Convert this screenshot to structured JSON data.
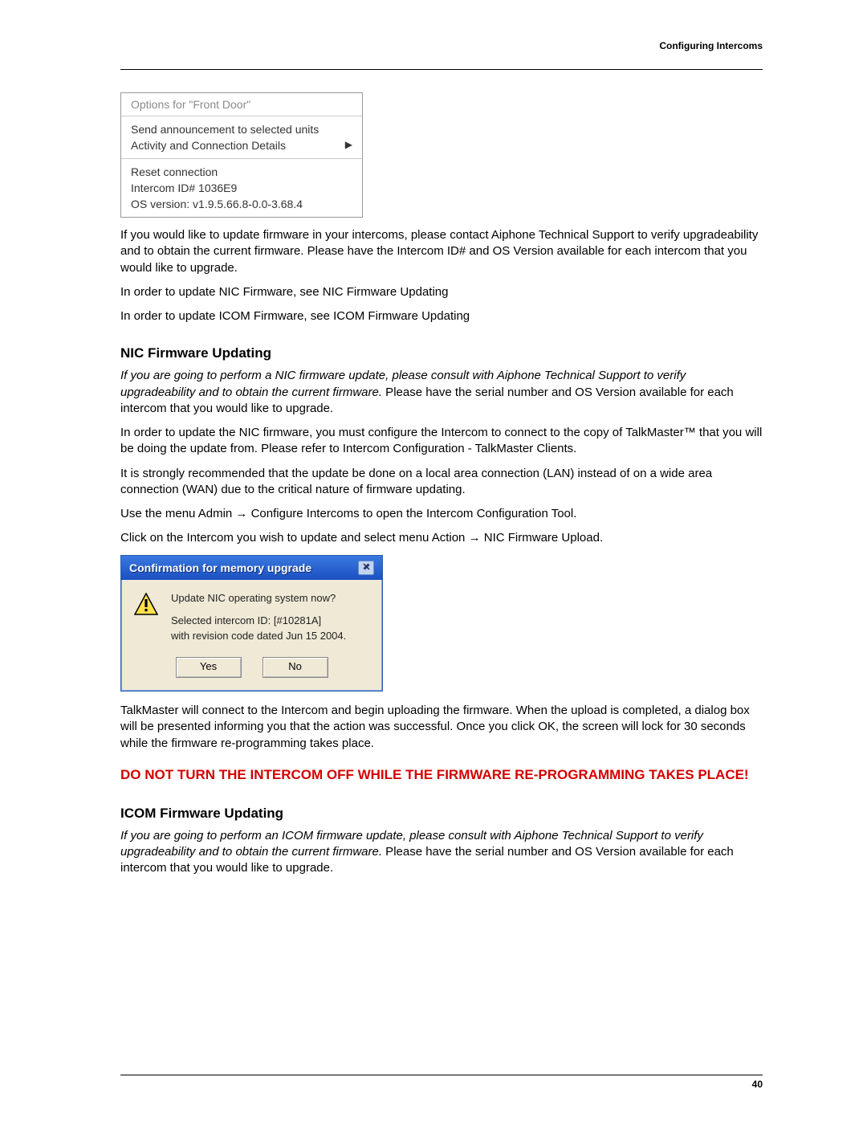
{
  "header": {
    "label": "Configuring Intercoms"
  },
  "footer": {
    "page": "40"
  },
  "context_menu": {
    "title": "Options for \"Front Door\"",
    "sec1": {
      "item1": "Send announcement to selected units",
      "item2": "Activity and Connection Details"
    },
    "sec2": {
      "item1": "Reset connection",
      "item2": "Intercom ID# 1036E9",
      "item3": "OS version: v1.9.5.66.8-0.0-3.68.4"
    }
  },
  "p1": "If you would like to update firmware in your intercoms, please contact Aiphone Technical Support to verify upgradeability and to obtain the current firmware.  Please have the Intercom ID# and OS Version available for each intercom that you would like to upgrade.",
  "p2": "In order to update NIC Firmware, see NIC Firmware Updating",
  "p3": "In order to update ICOM Firmware, see ICOM Firmware Updating",
  "section_nic": {
    "heading": "NIC Firmware Updating",
    "p1_italic": "If you are going to perform a NIC firmware update, please consult with Aiphone Technical Support to verify upgradeability and to obtain the current firmware.",
    "p1_rest": "  Please have the serial number and OS Version available for each intercom that you would like to upgrade.",
    "p2": "In order to update the NIC firmware, you must configure the Intercom to connect to the copy of TalkMaster™ that you will be doing the update from.  Please refer to Intercom Configuration - TalkMaster Clients.",
    "p3": "It is strongly recommended that the update be done on a local area connection (LAN) instead of on a wide area connection (WAN) due to the critical nature of firmware updating.",
    "p4_a": "Use the menu Admin ",
    "p4_b": " Configure Intercoms to open the Intercom Configuration Tool.",
    "p5_a": "Click on the Intercom you wish to update and select menu Action ",
    "p5_b": " NIC Firmware Upload."
  },
  "dialog": {
    "title": "Confirmation for memory upgrade",
    "line1": "Update NIC operating system now?",
    "line2": "Selected intercom ID: [#10281A]",
    "line3": "with revision code dated Jun 15 2004.",
    "yes": "Yes",
    "no": "No"
  },
  "p_after_dialog": "TalkMaster will connect to the Intercom and begin uploading the firmware.  When the upload is completed, a dialog box will be presented informing you that the action was successful. Once you click OK, the screen will lock for 30 seconds while the firmware re-programming takes place.",
  "warning": "DO NOT TURN THE INTERCOM OFF WHILE THE FIRMWARE RE-PROGRAMMING TAKES PLACE!",
  "section_icom": {
    "heading": "ICOM Firmware Updating",
    "p1_italic": "If you are going to perform an ICOM firmware update, please consult with Aiphone Technical Support to verify upgradeability and to obtain the current firmware.",
    "p1_rest": "  Please have the serial number and OS Version available for each intercom that you would like to upgrade."
  }
}
